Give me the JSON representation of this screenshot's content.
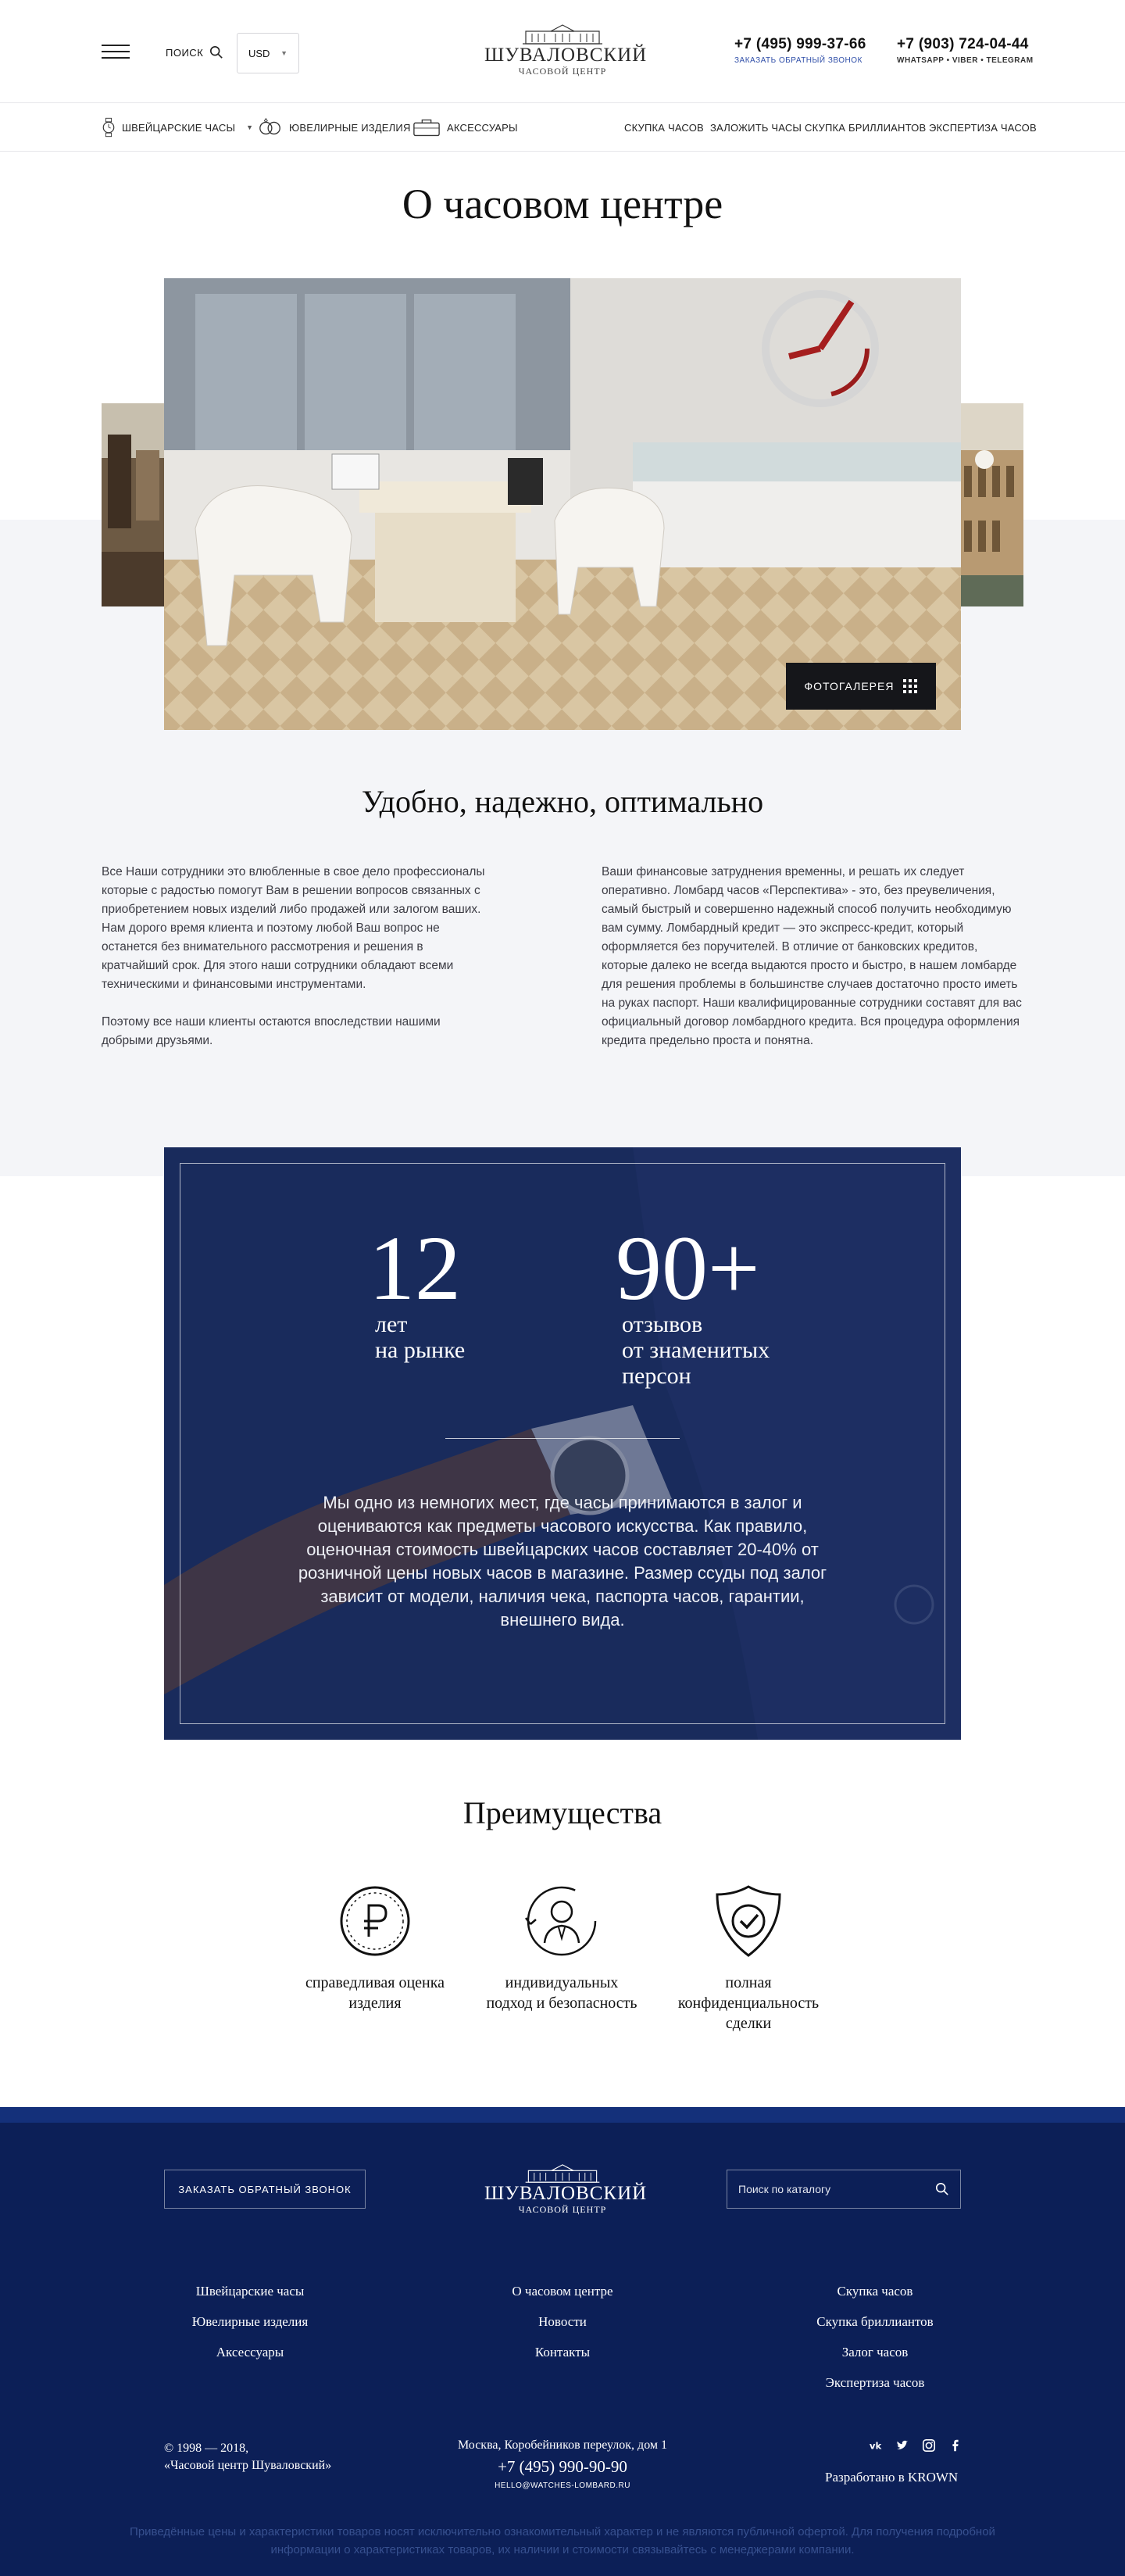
{
  "header": {
    "search_label": "ПОИСК",
    "currency": "USD",
    "logo_name": "ШУВАЛОВСКИЙ",
    "logo_sub": "ЧАСОВОЙ ЦЕНТР",
    "phone1": "+7 (495) 999-37-66",
    "phone1_note": "ЗАКАЗАТЬ ОБРАТНЫЙ ЗВОНОК",
    "phone2": "+7 (903) 724-04-44",
    "phone2_note": "WHATSAPP  •  VIBER  •  TELEGRAM"
  },
  "nav": {
    "left": [
      {
        "label": "Швейцарские часы",
        "icon": "watch-icon",
        "dropdown": true
      },
      {
        "label": "Ювелирные изделия",
        "icon": "rings-icon"
      },
      {
        "label": "Аксессуары",
        "icon": "bag-icon"
      }
    ],
    "right": [
      "Скупка часов",
      "Заложить часы",
      "Скупка бриллиантов",
      "Экспертиза часов"
    ]
  },
  "hero": {
    "title": "О часовом центре",
    "gallery_button": "ФОТОГАЛЕРЕЯ"
  },
  "about": {
    "title": "Удобно, надежно, оптимально",
    "left_p1": "Все Наши сотрудники это влюбленные в свое дело профессионалы которые с радостью помогут Вам в решении вопросов связанных с приобретением новых изделий либо продажей или залогом ваших. Нам дорого время клиента и поэтому любой Ваш вопрос не останется без внимательного рассмотрения и решения в кратчайший срок. Для этого наши сотрудники обладают всеми техническими и финансовыми инструментами.",
    "left_p2": "Поэтому все наши клиенты остаются впоследствии нашими добрыми друзьями.",
    "right_p1": "Ваши финансовые затруднения временны, и решать их следует оперативно. Ломбард часов «Перспектива» - это, без преувеличения, самый быстрый и совершенно надежный способ получить необходимую вам сумму. Ломбардный кредит — это экспресс-кредит, который оформляется без поручителей. В отличие от банковских кредитов, которые далеко не всегда выдаются просто и быстро, в нашем ломбарде для решения проблемы в большинстве случаев достаточно просто иметь на руках паспорт. Наши квалифицированные сотрудники составят для вас официальный договор ломбардного кредита. Вся процедура оформления кредита предельно проста и понятна."
  },
  "stats": {
    "stat1_value": "12",
    "stat1_label_line1": "лет",
    "stat1_label_line2": "на рынке",
    "stat2_value": "90+",
    "stat2_label_line1": "отзывов",
    "stat2_label_line2": "от знаменитых",
    "stat2_label_line3": "персон",
    "description": "Мы одно из немногих мест, где часы принимаются в залог и оцениваются как предметы часового искусства. Как правило, оценочная стоимость швейцарских часов составляет 20-40% от розничной цены новых часов в магазине. Размер ссуды под залог зависит от модели, наличия чека, паспорта часов, гарантии, внешнего вида."
  },
  "advantages": {
    "title": "Преимущества",
    "items": [
      {
        "icon": "ruble-coin-icon",
        "line1": "справедливая оценка",
        "line2": "изделия",
        "line3": ""
      },
      {
        "icon": "consultant-icon",
        "line1": "индивидуальных",
        "line2": "подход и безопасность",
        "line3": ""
      },
      {
        "icon": "shield-check-icon",
        "line1": "полная",
        "line2": "конфиденциальность",
        "line3": "сделки"
      }
    ]
  },
  "footer": {
    "callback": "ЗАКАЗАТЬ ОБРАТНЫЙ ЗВОНОК",
    "logo_name": "ШУВАЛОВСКИЙ",
    "logo_sub": "ЧАСОВОЙ ЦЕНТР",
    "search_placeholder": "Поиск по каталогу",
    "col1": [
      "Швейцарские часы",
      "Ювелирные изделия",
      "Аксессуары"
    ],
    "col2": [
      "О часовом центре",
      "Новости",
      "Контакты"
    ],
    "col3": [
      "Скупка часов",
      "Скупка бриллиантов",
      "Залог часов",
      "Экспертиза часов"
    ],
    "copyright_line1": "© 1998 — 2018,",
    "copyright_line2": "«Часовой центр Шуваловский»",
    "address": "Москва, Коробейников переулок, дом 1",
    "phone": "+7 (495) 990-90-90",
    "email": "HELLO@WATCHES-LOMBARD.RU",
    "social": [
      "vk-icon",
      "twitter-icon",
      "instagram-icon",
      "facebook-icon"
    ],
    "developer": "Разработано в KROWN",
    "disclaimer": "Приведённые цены и характеристики товаров носят исключительно ознакомительный характер и не являются публичной офертой. Для получения подробной информации о характеристиках товаров, их наличии и стоимости связывайтесь с менеджерами компании."
  },
  "colors": {
    "accent_link": "#2f4ea8",
    "stats_bg": "#1b2d5e",
    "footer_bg": "#0c1f57",
    "gray_band": "#f4f5f8"
  }
}
